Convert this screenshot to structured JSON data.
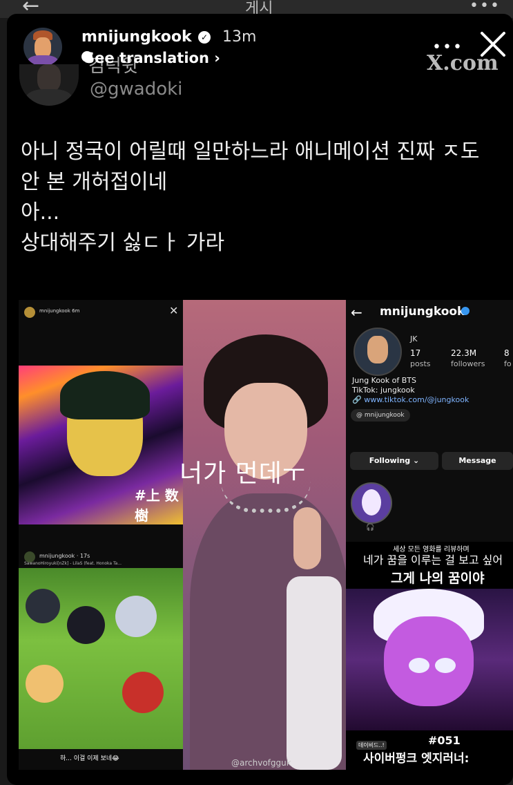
{
  "top_bar": {
    "back": "←",
    "title": "게시",
    "more": "•••"
  },
  "story": {
    "username": "mnijungkook",
    "time": "13m",
    "see_translation": "See translation",
    "chevron": "›",
    "more": "•••"
  },
  "tweet": {
    "name": "김덕윗",
    "handle": "@gwadoki",
    "source": "X.com",
    "body": "아니 정국이 어릴때 일만하느라 애니메이션 진짜 ㅈ도\n안 본 개허접이네\n아...\n상대해주기 싫ㄷㅏ 가라"
  },
  "collage": {
    "left_top": {
      "username": "mnijungkook",
      "time": "6m",
      "overlay_text": "#上 数 樹"
    },
    "left_bottom": {
      "username": "mnijungkook",
      "time": "17s",
      "song": "SawanoHiroyuki[nZk] - LilaS (feat. Honoka Ta...",
      "caption": "하... 이걸 이제 보네😂"
    },
    "middle": {
      "caption": "너가 먼데ㅜ",
      "watermark": "@archvofgguk"
    },
    "right_profile": {
      "back": "←",
      "username": "mnijungkook",
      "name": "JK",
      "posts_count": "17",
      "posts_label": "posts",
      "followers_count": "22.3M",
      "followers_label": "followers",
      "following_count": "8",
      "following_label": "fo",
      "bio_1": "Jung Kook of BTS",
      "bio_2": "TikTok: jungkook",
      "link": "www.tiktok.com/@jungkook",
      "threads": "mnijungkook",
      "following_button": "Following ⌄",
      "message_button": "Message"
    },
    "right_bottom": {
      "line1": "세상 모든 영화를 리뷰하며",
      "line2": "네가 꿈을 이루는 걸 보고 싶어",
      "line3": "그게 나의 꿈이야",
      "tag": "데이비드..!",
      "number": "#051",
      "title": "사이버펑크 엣지러너:"
    }
  },
  "colors": {
    "background": "#000000",
    "verified": "#3897f0",
    "link": "#7fb4ff"
  }
}
